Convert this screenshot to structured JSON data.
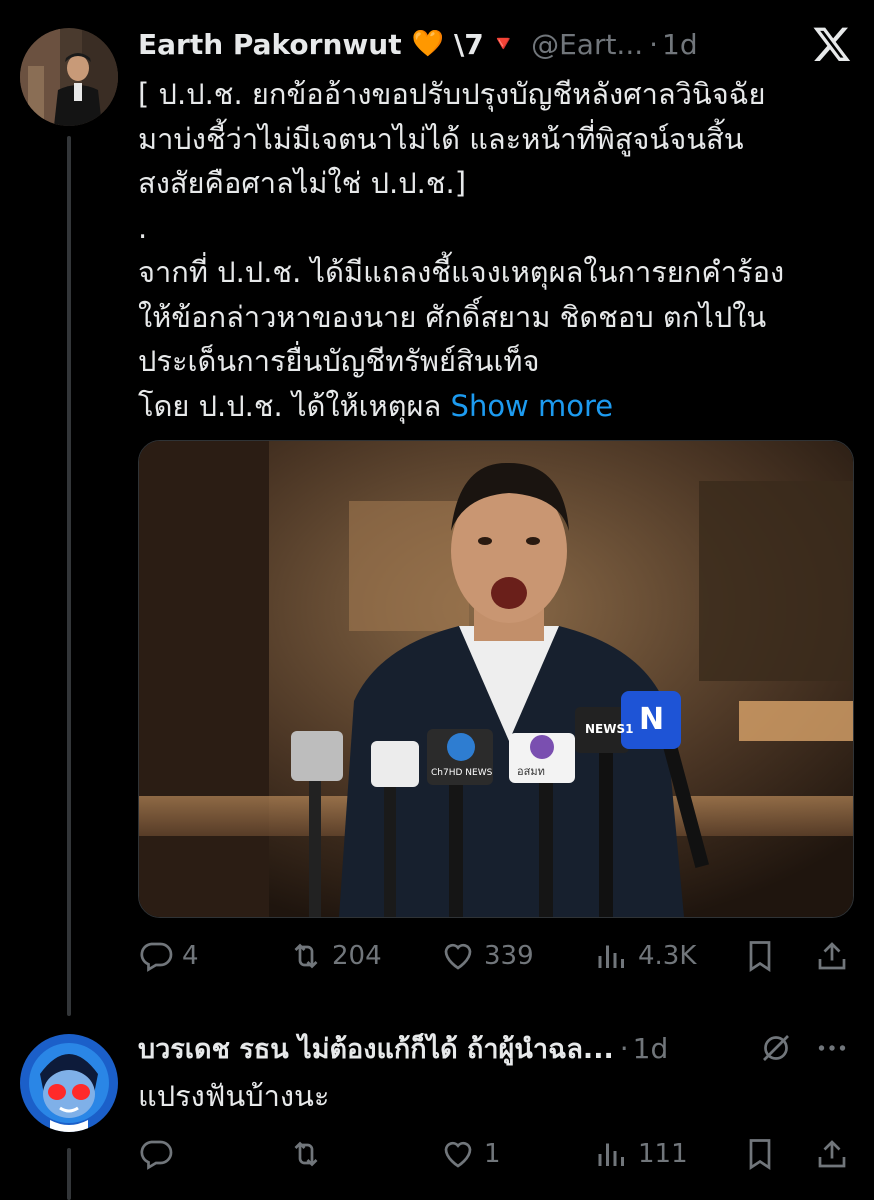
{
  "tweet": {
    "author_name": "Earth Pakornwut",
    "author_emoji": "🧡",
    "author_suffix": "\\7",
    "author_badge": "🔻",
    "handle": "@Eart...",
    "separator": "·",
    "time": "1d",
    "text_lines": [
      "[ ป.ป.ช. ยกข้ออ้างขอปรับปรุงบัญชีหลังศาลวินิจฉัย",
      "มาบ่งชี้ว่าไม่มีเจตนาไม่ได้ และหน้าที่พิสูจน์จนสิ้น",
      "สงสัยคือศาลไม่ใช่ ป.ป.ช.]",
      ".",
      "จากที่ ป.ป.ช. ได้มีแถลงชี้แจงเหตุผลในการยกคำร้อง",
      "ให้ข้อกล่าวหาของนาย ศักดิ์สยาม ชิดชอบ ตกไปใน",
      "ประเด็นการยื่นบัญชีทรัพย์สินเท็จ",
      "โดย ป.ป.ช. ได้ให้เหตุผล"
    ],
    "show_more": "Show more",
    "mic_labels": [
      "NEWS1",
      "N",
      "Ch7HD NEWS",
      "อสมท"
    ],
    "stats": {
      "replies": "4",
      "reposts": "204",
      "likes": "339",
      "views": "4.3K"
    }
  },
  "reply": {
    "author_name": "บวรเดช รธน ไม่ต้องแก้ก็ได้ ถ้าผู้นำฉล...",
    "separator": "·",
    "time": "1d",
    "text": "แปรงฟันบ้างนะ",
    "stats": {
      "replies": "",
      "reposts": "",
      "likes": "1",
      "views": "111"
    }
  },
  "icons": [
    "x-logo-icon",
    "reply-icon",
    "repost-icon",
    "like-icon",
    "views-icon",
    "bookmark-icon",
    "share-icon",
    "grok-slash-icon",
    "more-icon"
  ],
  "colors": {
    "background": "#000000",
    "text": "#e7e9ea",
    "muted": "#71767b",
    "link": "#1d9bf0",
    "thread_line": "#333639"
  }
}
